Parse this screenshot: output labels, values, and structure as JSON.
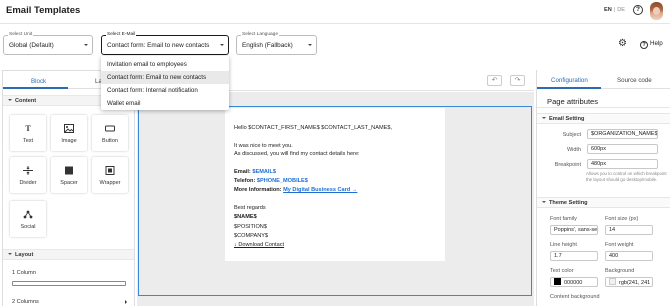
{
  "header": {
    "title": "Email Templates",
    "lang_active": "EN",
    "lang_sep": "|",
    "lang_other": "DE"
  },
  "selects": {
    "unit": {
      "label": "Select Unit",
      "value": "Global (Default)"
    },
    "email": {
      "label": "Select E-Mail",
      "value": "Contact form: Email to new contacts"
    },
    "language": {
      "label": "Select Language",
      "value": "English (Fallback)"
    }
  },
  "toolbar": {
    "help_label": "Help"
  },
  "dropdown": {
    "options": [
      "Invitation email to employees",
      "Contact form: Email to new contacts",
      "Contact form: Internal notification",
      "Wallet email"
    ],
    "selected_index": 1
  },
  "left_panel": {
    "tabs": [
      "Block",
      "La"
    ],
    "content_section": "Content",
    "blocks": [
      {
        "label": "Text",
        "icon": "text-icon"
      },
      {
        "label": "Image",
        "icon": "image-icon"
      },
      {
        "label": "Button",
        "icon": "button-icon"
      },
      {
        "label": "Divider",
        "icon": "divider-icon"
      },
      {
        "label": "Spacer",
        "icon": "spacer-icon"
      },
      {
        "label": "Wrapper",
        "icon": "wrapper-icon"
      },
      {
        "label": "Social",
        "icon": "social-icon"
      }
    ],
    "layout_section": "Layout",
    "layouts": [
      "1 Column",
      "2 Columns"
    ]
  },
  "email_preview": {
    "greeting": "Hello $CONTACT_FIRST_NAME$ $CONTACT_LAST_NAME$,",
    "line1": "It was nice to meet you.",
    "line2": "As discussed, you will find my contact details here:",
    "email_label": "Email:",
    "email_value": "$EMAIL$",
    "phone_label": "Telefon:",
    "phone_value": "$PHONE_MOBILE$",
    "more_label": "More Information:",
    "more_link": "My Digital Business Card →",
    "regards": "Best regards",
    "name": "$NAME$",
    "position": "$POSITION$",
    "company": "$COMPANY$",
    "download": "↓ Download Contact"
  },
  "right_panel": {
    "tabs": [
      "Configuration",
      "Source code"
    ],
    "page_attributes": "Page attributes",
    "email_setting": "Email Setting",
    "subject_label": "Subject",
    "subject_value": "$ORGANIZATION_NAME$",
    "width_label": "Width",
    "width_value": "600px",
    "breakpoint_label": "Breakpoint",
    "breakpoint_value": "480px",
    "breakpoint_hint": "Allows you to control on which breakpoint the layout should go desktop/mobile.",
    "theme_setting": "Theme Setting",
    "font_family_label": "Font family",
    "font_family_value": "Poppins', sans-serif",
    "font_size_label": "Font size (px)",
    "font_size_value": "14",
    "line_height_label": "Line height",
    "line_height_value": "1.7",
    "font_weight_label": "Font weight",
    "font_weight_value": "400",
    "text_color_label": "Text color",
    "text_color_value": "000000",
    "background_label": "Background",
    "background_value": "rgb(241, 241",
    "content_bg_label": "Content background"
  },
  "colors": {
    "accent": "#2b6cb0",
    "selection_frame": "#3a86d9",
    "link": "#1d6fd6",
    "text_color_swatch": "#000000",
    "background_swatch": "#f1f1f1"
  }
}
